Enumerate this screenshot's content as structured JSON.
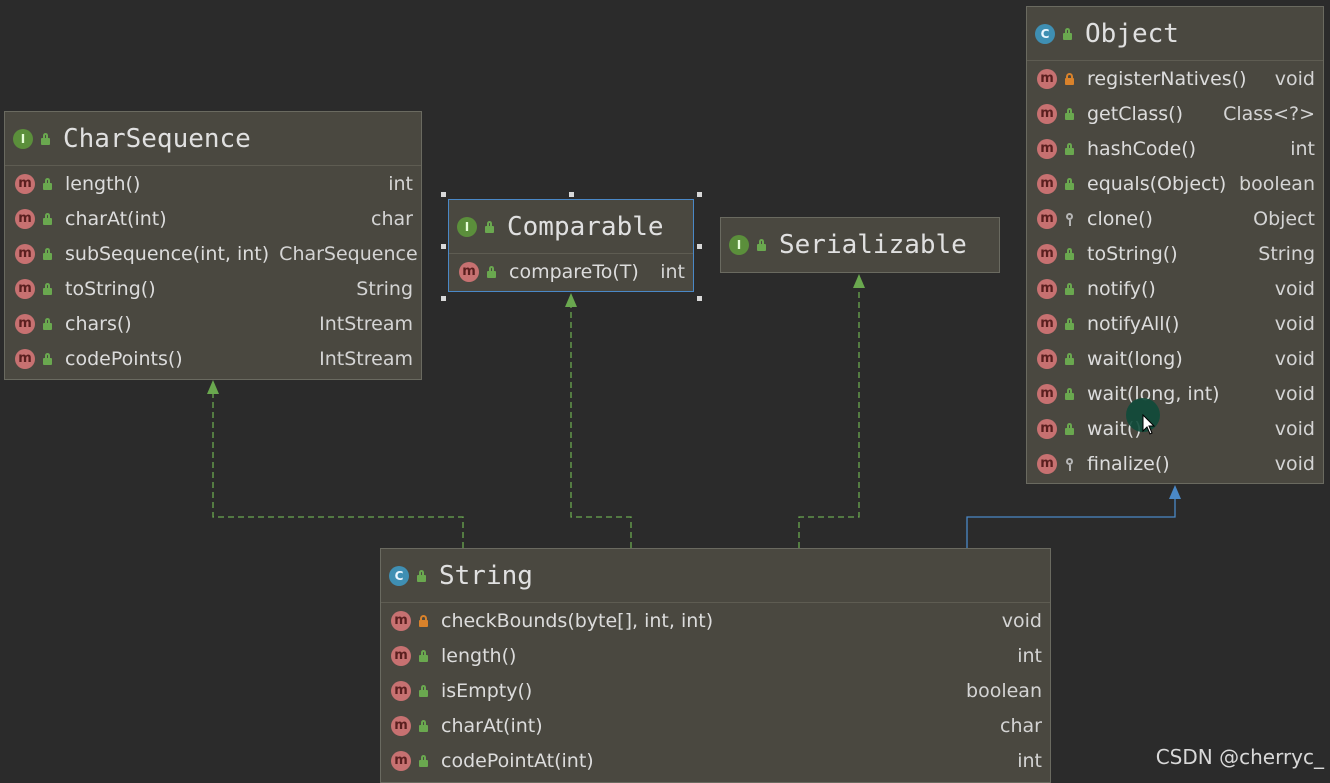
{
  "diagram": {
    "char_sequence": {
      "kind": "I",
      "title": "CharSequence",
      "methods": [
        {
          "name": "length()",
          "type": "int",
          "visibility": "public"
        },
        {
          "name": "charAt(int)",
          "type": "char",
          "visibility": "public"
        },
        {
          "name": "subSequence(int, int)",
          "type": "CharSequence",
          "visibility": "public"
        },
        {
          "name": "toString()",
          "type": "String",
          "visibility": "public"
        },
        {
          "name": "chars()",
          "type": "IntStream",
          "visibility": "public"
        },
        {
          "name": "codePoints()",
          "type": "IntStream",
          "visibility": "public"
        }
      ]
    },
    "comparable": {
      "kind": "I",
      "title": "Comparable",
      "methods": [
        {
          "name": "compareTo(T)",
          "type": "int",
          "visibility": "public"
        }
      ]
    },
    "serializable": {
      "kind": "I",
      "title": "Serializable"
    },
    "object": {
      "kind": "C",
      "title": "Object",
      "methods": [
        {
          "name": "registerNatives()",
          "type": "void",
          "visibility": "private"
        },
        {
          "name": "getClass()",
          "type": "Class<?>",
          "visibility": "public"
        },
        {
          "name": "hashCode()",
          "type": "int",
          "visibility": "public"
        },
        {
          "name": "equals(Object)",
          "type": "boolean",
          "visibility": "public"
        },
        {
          "name": "clone()",
          "type": "Object",
          "visibility": "protected"
        },
        {
          "name": "toString()",
          "type": "String",
          "visibility": "public"
        },
        {
          "name": "notify()",
          "type": "void",
          "visibility": "public"
        },
        {
          "name": "notifyAll()",
          "type": "void",
          "visibility": "public"
        },
        {
          "name": "wait(long)",
          "type": "void",
          "visibility": "public"
        },
        {
          "name": "wait(long, int)",
          "type": "void",
          "visibility": "public"
        },
        {
          "name": "wait()",
          "type": "void",
          "visibility": "public"
        },
        {
          "name": "finalize()",
          "type": "void",
          "visibility": "protected"
        }
      ]
    },
    "string": {
      "kind": "C",
      "title": "String",
      "methods": [
        {
          "name": "checkBounds(byte[], int, int)",
          "type": "void",
          "visibility": "private"
        },
        {
          "name": "length()",
          "type": "int",
          "visibility": "public"
        },
        {
          "name": "isEmpty()",
          "type": "boolean",
          "visibility": "public"
        },
        {
          "name": "charAt(int)",
          "type": "char",
          "visibility": "public"
        },
        {
          "name": "codePointAt(int)",
          "type": "int",
          "visibility": "public"
        }
      ]
    }
  },
  "colors": {
    "background": "#2b2b2b",
    "box_fill": "#4a4840",
    "implements_edge": "#6aa84f",
    "extends_edge": "#4a88c7"
  },
  "watermark": "CSDN @cherryc_"
}
